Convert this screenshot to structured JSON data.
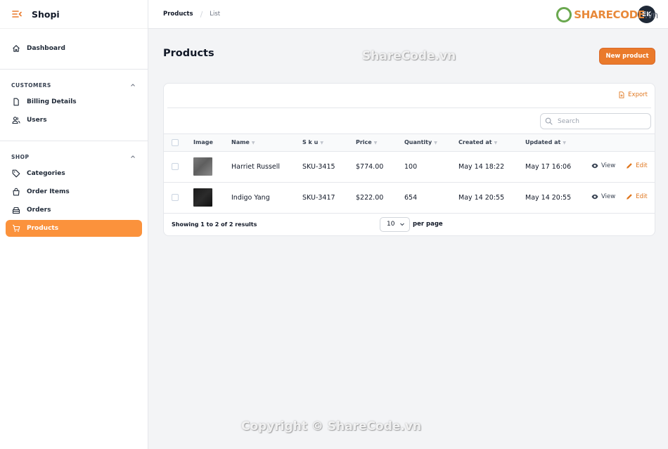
{
  "app": {
    "name": "Shopi"
  },
  "sidebar": {
    "dashboard": "Dashboard",
    "groups": [
      {
        "label": "CUSTOMERS",
        "items": [
          "Billing Details",
          "Users"
        ]
      },
      {
        "label": "SHOP",
        "items": [
          "Categories",
          "Order Items",
          "Orders",
          "Products"
        ]
      }
    ],
    "active": "Products"
  },
  "breadcrumb": {
    "parent": "Products",
    "current": "List"
  },
  "user": {
    "initials": "EK"
  },
  "watermark": {
    "logo": "SHARECODE",
    "logo_suffix": ".vn",
    "top": "ShareCode.vn",
    "bottom": "Copyright © ShareCode.vn"
  },
  "page": {
    "title": "Products",
    "new_button": "New product"
  },
  "toolbar": {
    "export_label": "Export",
    "search_placeholder": "Search"
  },
  "table": {
    "columns": [
      "Image",
      "Name",
      "S k u",
      "Price",
      "Quantity",
      "Created at",
      "Updated at"
    ],
    "rows": [
      {
        "name": "Harriet Russell",
        "sku": "SKU-3415",
        "price": "$774.00",
        "quantity": "100",
        "created": "May 14 18:22",
        "updated": "May 17 16:06"
      },
      {
        "name": "Indigo Yang",
        "sku": "SKU-3417",
        "price": "$222.00",
        "quantity": "654",
        "created": "May 14 20:55",
        "updated": "May 14 20:55"
      }
    ],
    "actions": {
      "view": "View",
      "edit": "Edit"
    }
  },
  "footer": {
    "summary": "Showing 1 to 2 of 2 results",
    "per_page_value": "10",
    "per_page_label": "per page"
  },
  "colors": {
    "accent": "#ea7a2b",
    "active_nav": "#fb923c"
  }
}
